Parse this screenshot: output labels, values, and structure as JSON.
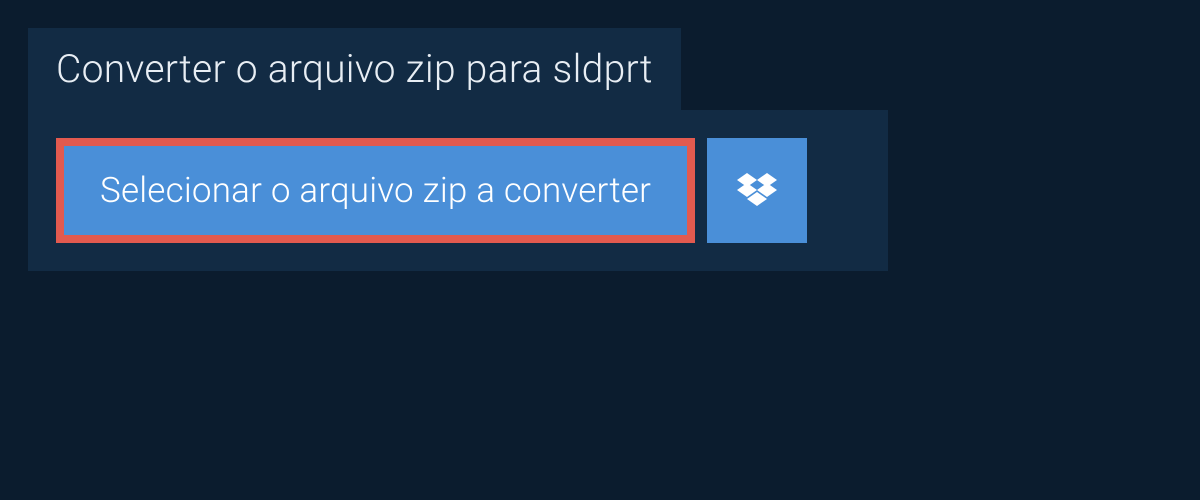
{
  "header": {
    "title": "Converter o arquivo zip para sldprt"
  },
  "actions": {
    "select_file_label": "Selecionar o arquivo zip a converter"
  },
  "colors": {
    "background": "#0b1c2e",
    "panel": "#122b44",
    "button": "#4a8fd8",
    "highlight_border": "#e25a4f",
    "text_light": "#e8eef4",
    "text_white": "#ffffff"
  }
}
